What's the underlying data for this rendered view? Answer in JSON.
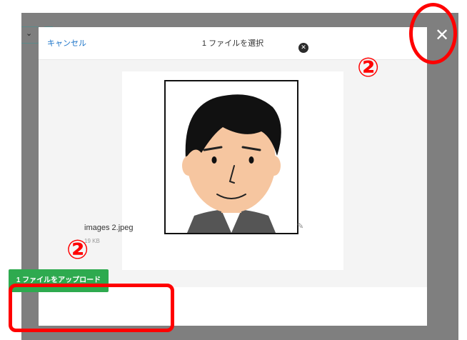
{
  "header": {
    "cancel_label": "キャンセル",
    "title": "1 ファイルを選択"
  },
  "file": {
    "name": "images 2.jpeg",
    "size": "19 KB"
  },
  "footer": {
    "upload_label": "1 ファイルをアップロード"
  },
  "annotations": {
    "step_top": "②",
    "step_bottom": "②"
  },
  "colors": {
    "accent_green": "#2eaa4f",
    "link_blue": "#1a73c8",
    "annotation_red": "#ff0000",
    "backdrop": "#7f7f7f"
  },
  "icons": {
    "close": "close-icon",
    "remove": "remove-file-icon",
    "edit": "edit-icon",
    "dropdown": "chevron-down-icon"
  }
}
